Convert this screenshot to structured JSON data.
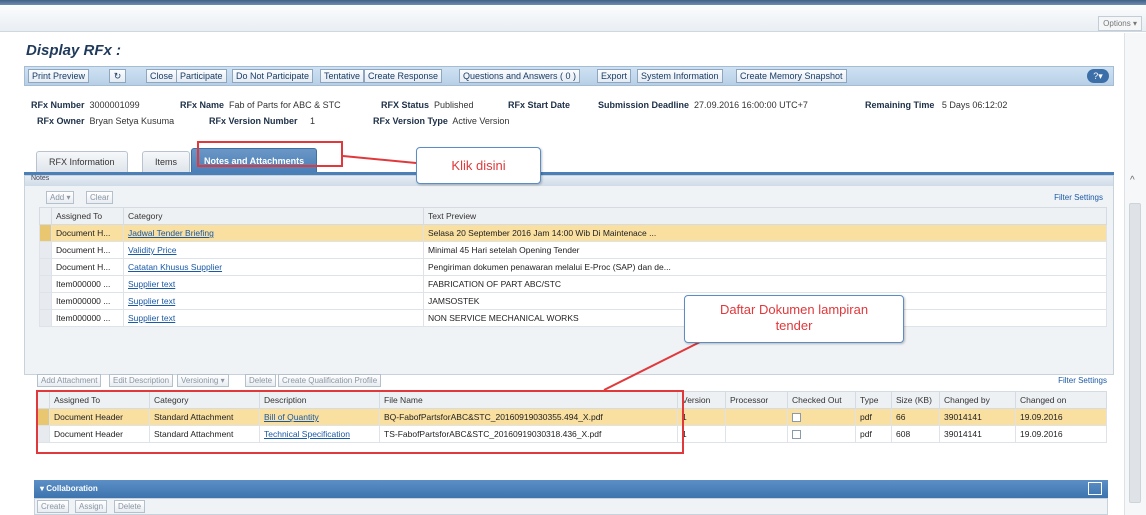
{
  "options": "Options",
  "title": "Display RFx :",
  "toolbar": {
    "print_preview": "Print Preview",
    "refresh_icon": "refresh-icon",
    "close": "Close",
    "participate": "Participate",
    "do_not_participate": "Do Not Participate",
    "tentative": "Tentative",
    "create_response": "Create Response",
    "qa": "Questions and Answers ( 0 )",
    "export": "Export",
    "system_information": "System Information",
    "memory_snapshot": "Create Memory Snapshot"
  },
  "header": {
    "rfx_number_label": "RFx Number",
    "rfx_number": "3000001099",
    "rfx_name_label": "RFx Name",
    "rfx_name": "Fab of Parts for ABC & STC",
    "rfx_status_label": "RFX Status",
    "rfx_status": "Published",
    "rfx_start_date_label": "RFx Start Date",
    "submission_deadline_label": "Submission Deadline",
    "submission_deadline": "27.09.2016 16:00:00 UTC+7",
    "remaining_time_label": "Remaining Time",
    "remaining_time": "5 Days 06:12:02",
    "rfx_owner_label": "RFx Owner",
    "rfx_owner": "Bryan Setya Kusuma",
    "rfx_version_number_label": "RFx Version Number",
    "rfx_version_number": "1",
    "rfx_version_type_label": "RFx Version Type",
    "rfx_version_type": "Active Version"
  },
  "tabs": [
    "RFX Information",
    "Items",
    "Notes and Attachments"
  ],
  "notes": {
    "section_label": "Notes",
    "add": "Add",
    "clear": "Clear",
    "filter_settings": "Filter Settings",
    "columns": [
      "Assigned To",
      "Category",
      "Text Preview"
    ],
    "rows": [
      [
        "Document H...",
        "Jadwal Tender Briefing",
        "Selasa 20 September 2016  Jam 14:00 Wib Di Maintenace ..."
      ],
      [
        "Document H...",
        "Validity Price",
        "Minimal 45 Hari setelah Opening Tender"
      ],
      [
        "Document H...",
        "Catatan Khusus Supplier",
        "Pengiriman dokumen penawaran melalui E-Proc (SAP) dan de..."
      ],
      [
        "Item000000 ...",
        "Supplier text",
        "FABRICATION OF PART ABC/STC"
      ],
      [
        "Item000000 ...",
        "Supplier text",
        "JAMSOSTEK"
      ],
      [
        "Item000000 ...",
        "Supplier text",
        "NON SERVICE MECHANICAL WORKS"
      ]
    ]
  },
  "attachments": {
    "add_attachment": "Add Attachment",
    "edit_description": "Edit Description",
    "versioning": "Versioning",
    "delete": "Delete",
    "create_qualification_profile": "Create Qualification Profile",
    "filter_settings": "Filter Settings",
    "columns": [
      "Assigned To",
      "Category",
      "Description",
      "File Name",
      "Version",
      "Processor",
      "Checked Out",
      "Type",
      "Size (KB)",
      "Changed by",
      "Changed on"
    ],
    "rows": [
      [
        "Document Header",
        "Standard Attachment",
        "Bill of Quantity",
        "BQ-FabofPartsforABC&STC_20160919030355.494_X.pdf",
        "1",
        "",
        "",
        "pdf",
        "66",
        "39014141",
        "19.09.2016"
      ],
      [
        "Document Header",
        "Standard Attachment",
        "Technical Specification",
        "TS-FabofPartsforABC&STC_20160919030318.436_X.pdf",
        "1",
        "",
        "",
        "pdf",
        "608",
        "39014141",
        "19.09.2016"
      ]
    ]
  },
  "callouts": {
    "klik": "Klik disini",
    "daftar": "Daftar Dokumen lampiran tender"
  },
  "collaboration": {
    "title": "Collaboration",
    "create": "Create",
    "assign": "Assign",
    "delete": "Delete"
  },
  "colors": {
    "accent": "#4a7fb8",
    "selected_row": "#f9dfa0",
    "annotation": "#e0383b"
  }
}
